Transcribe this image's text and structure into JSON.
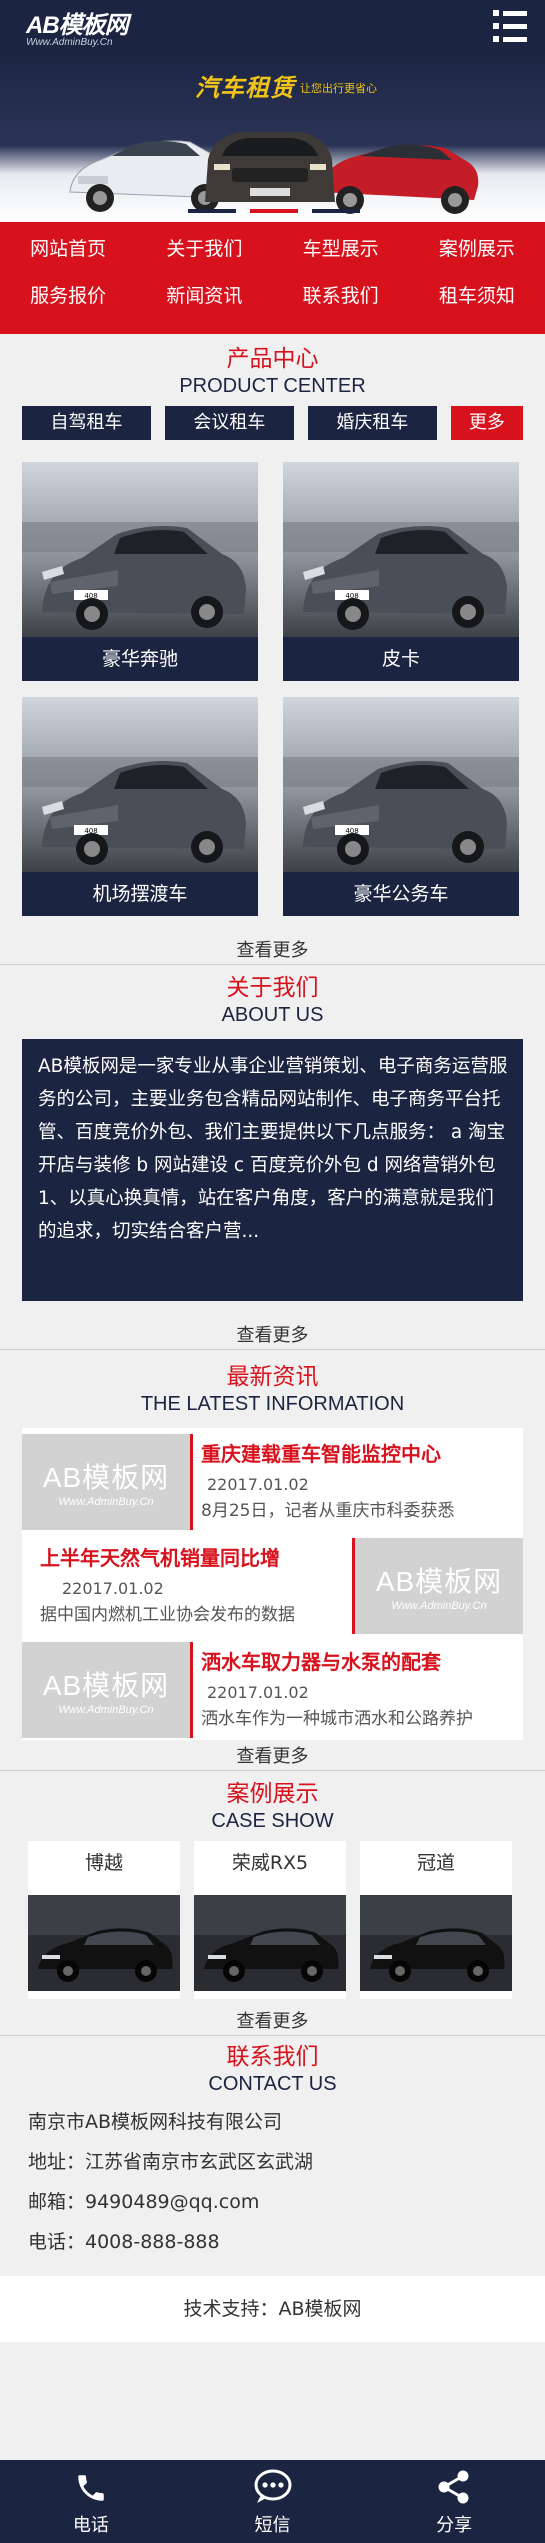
{
  "header": {
    "logo_main": "AB模板网",
    "logo_sub": "Www.AdminBuy.Cn",
    "menu_icon": "menu-icon"
  },
  "banner": {
    "title": "汽车租赁",
    "subtitle": "让您出行更省心"
  },
  "nav": {
    "items": [
      {
        "label": "网站首页"
      },
      {
        "label": "关于我们"
      },
      {
        "label": "车型展示"
      },
      {
        "label": "案例展示"
      },
      {
        "label": "服务报价"
      },
      {
        "label": "新闻资讯"
      },
      {
        "label": "联系我们"
      },
      {
        "label": "租车须知"
      }
    ]
  },
  "products": {
    "title_cn": "产品中心",
    "title_en": "PRODUCT CENTER",
    "tabs": [
      {
        "label": "自驾租车"
      },
      {
        "label": "会议租车"
      },
      {
        "label": "婚庆租车"
      },
      {
        "label": "更多"
      }
    ],
    "items": [
      {
        "name": "豪华奔驰"
      },
      {
        "name": "皮卡"
      },
      {
        "name": "机场摆渡车"
      },
      {
        "name": "豪华公务车"
      }
    ],
    "more": "查看更多"
  },
  "about": {
    "title_cn": "关于我们",
    "title_en": "ABOUT US",
    "text": "AB模板网是一家专业从事企业营销策划、电子商务运营服务的公司，主要业务包含精品网站制作、电子商务平台托管、百度竞价外包、我们主要提供以下几点服务： a 淘宝开店与装修 b 网站建设 c 百度竞价外包 d 网络营销外包 1、以真心换真情，站在客户角度，客户的满意就是我们的追求，切实结合客户营...",
    "more": "查看更多"
  },
  "news": {
    "title_cn": "最新资讯",
    "title_en": "THE LATEST INFORMATION",
    "thumb_text": "AB模板网",
    "thumb_sub": "Www.AdminBuy.Cn",
    "items": [
      {
        "title": "重庆建载重车智能监控中心",
        "date": "22017.01.02",
        "desc": "8月25日，记者从重庆市科委获悉"
      },
      {
        "title": "上半年天然气机销量同比增",
        "date": "22017.01.02",
        "desc": "据中国内燃机工业协会发布的数据"
      },
      {
        "title": "洒水车取力器与水泵的配套",
        "date": "22017.01.02",
        "desc": "洒水车作为一种城市洒水和公路养护"
      }
    ],
    "more": "查看更多"
  },
  "cases": {
    "title_cn": "案例展示",
    "title_en": "CASE SHOW",
    "items": [
      {
        "name": "博越"
      },
      {
        "name": "荣威RX5"
      },
      {
        "name": "冠道"
      }
    ],
    "more": "查看更多"
  },
  "contact": {
    "title_cn": "联系我们",
    "title_en": "CONTACT US",
    "company": "南京市AB模板网科技有限公司",
    "address": "地址：江苏省南京市玄武区玄武湖",
    "email": "邮箱：9490489@qq.com",
    "phone": "电话：4008-888-888"
  },
  "support": "技术支持：AB模板网",
  "footer": {
    "items": [
      {
        "label": "电话",
        "icon": "phone-icon"
      },
      {
        "label": "短信",
        "icon": "message-icon"
      },
      {
        "label": "分享",
        "icon": "share-icon"
      }
    ]
  },
  "colors": {
    "primary": "#1b2440",
    "accent": "#d7121d",
    "banner_text": "#f2c417"
  }
}
